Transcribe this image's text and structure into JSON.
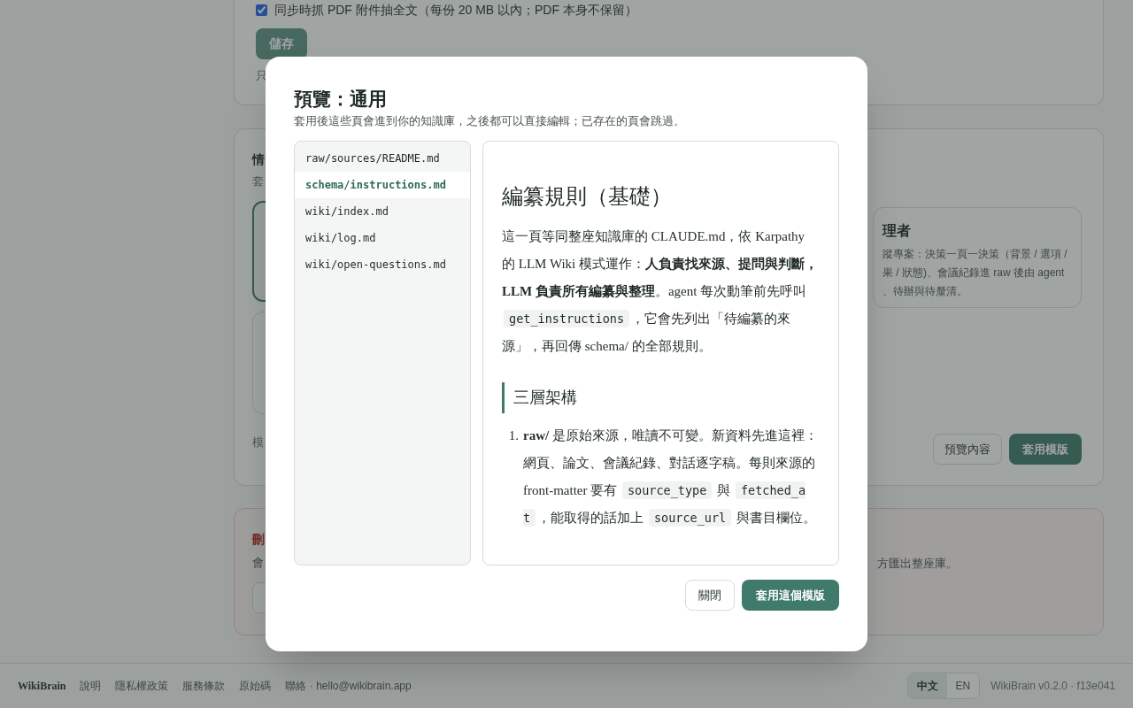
{
  "background": {
    "sync_option": {
      "label": "同步時抓 PDF 附件抽全文（每份 20 MB 以內；PDF 本身不保留）",
      "checked": true
    },
    "save_button": "儲存",
    "card1_fragment": "只",
    "templates_section": {
      "title_fragment": "情",
      "desc_fragment": "套",
      "footer_fragment": "模",
      "right_card": {
        "title_fragment": "理者",
        "lines": [
          "蹤專案：決策一頁一決策（背景 / 選項 /",
          "果 / 狀態)、會議紀錄進 raw 後由 agent",
          "、待辦與待釐清。"
        ]
      },
      "buttons": [
        "預覽內容",
        "套用模版"
      ]
    },
    "danger_section": {
      "title_fragment": "刪",
      "desc_fragment": "會",
      "desc_right_fragment": "方匯出整座庫。"
    }
  },
  "modal": {
    "title": "預覽：通用",
    "subtitle": "套用後這些頁會進到你的知識庫，之後都可以直接編輯；已存在的頁會跳過。",
    "files": [
      {
        "name": "raw/sources/README.md",
        "selected": false
      },
      {
        "name": "schema/instructions.md",
        "selected": true
      },
      {
        "name": "wiki/index.md",
        "selected": false
      },
      {
        "name": "wiki/log.md",
        "selected": false
      },
      {
        "name": "wiki/open-questions.md",
        "selected": false
      }
    ],
    "preview": {
      "heading": "編纂規則（基礎）",
      "paragraph": [
        {
          "kind": "text",
          "text": "這一頁等同整座知識庫的 CLAUDE.md，依 Karpathy 的 LLM Wiki 模式運作：**人負責找來源、提問與判斷，LLM 負責所有編纂與整理**。agent 每次動筆前先呼叫 "
        },
        {
          "kind": "code",
          "text": "get_instructions"
        },
        {
          "kind": "text",
          "text": "，它會先列出「待編纂的來源」，再回傳 schema/ 的全部規則。"
        }
      ],
      "subheading": "三層架構",
      "list": [
        {
          "number": "1.",
          "segments": [
            {
              "kind": "text",
              "text": "**raw/** 是原始來源，唯讀不可變。新資料先進這裡：網頁、論文、會議紀錄、對話逐字稿。每則來源的 front-matter 要有 "
            },
            {
              "kind": "code",
              "text": "source_type"
            },
            {
              "kind": "text",
              "text": " 與 "
            },
            {
              "kind": "code",
              "text": "fetched_at"
            },
            {
              "kind": "text",
              "text": "，能取得的話加上 "
            },
            {
              "kind": "code",
              "text": "source_url"
            },
            {
              "kind": "text",
              "text": " 與書目欄位。"
            }
          ]
        }
      ]
    },
    "buttons": [
      {
        "label": "關閉",
        "kind": "secondary"
      },
      {
        "label": "套用這個模版",
        "kind": "primary"
      }
    ]
  },
  "footer": {
    "brand": "WikiBrain",
    "links": [
      "說明",
      "隱私權政策",
      "服務條款",
      "原始碼",
      "聯絡 · hello@wikibrain.app"
    ],
    "languages": [
      {
        "label": "中文",
        "selected": true
      },
      {
        "label": "EN",
        "selected": false
      }
    ],
    "version": "WikiBrain v0.2.0 · f13e041"
  }
}
